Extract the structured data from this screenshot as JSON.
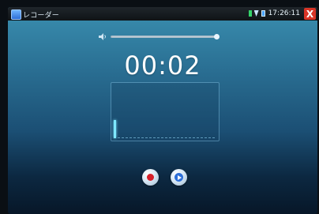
{
  "status_bar": {
    "app_title": "レコーダー",
    "time": "17:26:11",
    "close_label": "X"
  },
  "timer": "00:02",
  "volume": {
    "level": 1.0
  },
  "input_level": {
    "level": 0.35
  },
  "controls": {
    "record_icon": "record-icon",
    "play_icon": "play-icon"
  }
}
